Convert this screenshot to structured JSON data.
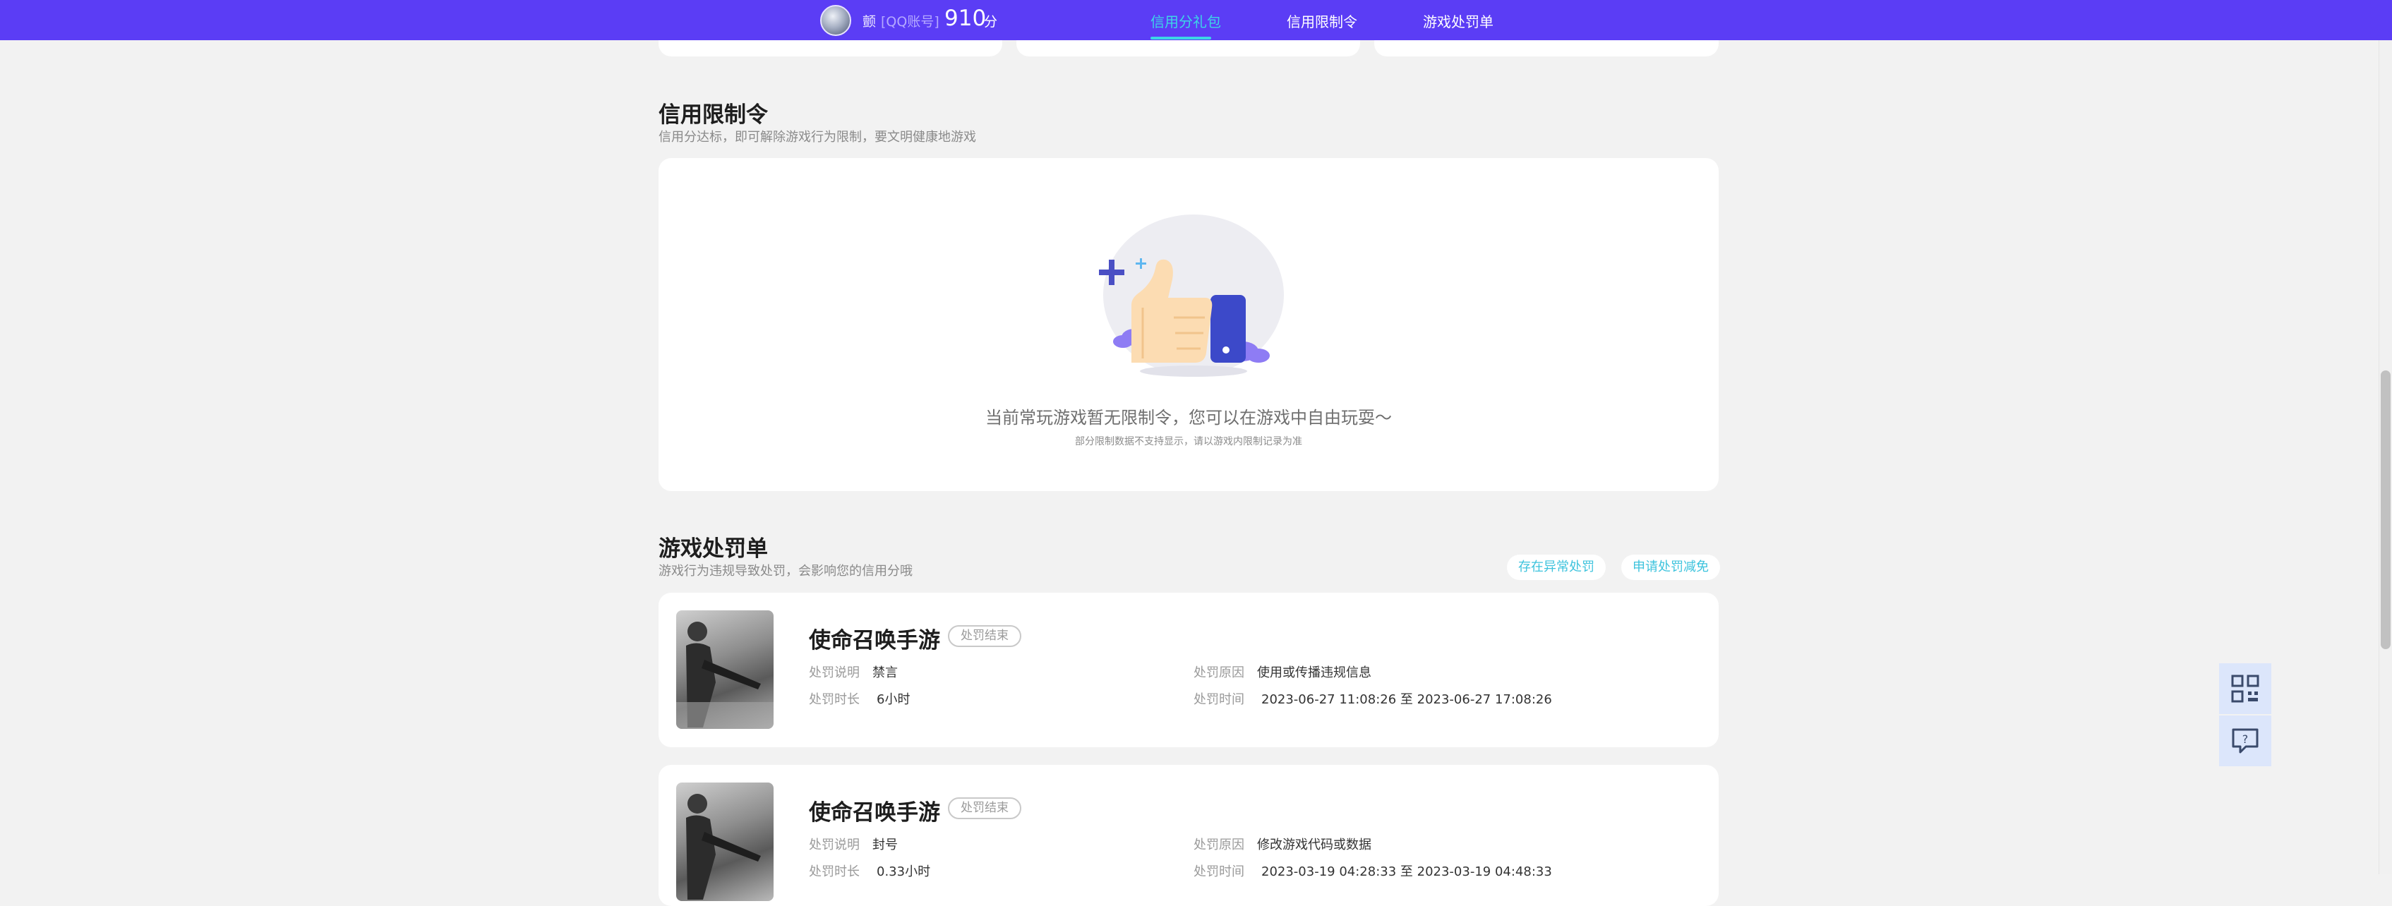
{
  "header": {
    "user_name": "颤",
    "account_type": "[QQ账号]",
    "score": "910",
    "score_unit": "分",
    "tabs": [
      {
        "label": "信用分礼包",
        "active": true
      },
      {
        "label": "信用限制令",
        "active": false
      },
      {
        "label": "游戏处罚单",
        "active": false
      }
    ]
  },
  "restriction": {
    "title": "信用限制令",
    "subtitle": "信用分达标，即可解除游戏行为限制，要文明健康地游戏",
    "empty_main": "当前常玩游戏暂无限制令，您可以在游戏中自由玩耍～",
    "empty_sub": "部分限制数据不支持显示，请以游戏内限制记录为准"
  },
  "penalty": {
    "title": "游戏处罚单",
    "subtitle": "游戏行为违规导致处罚，会影响您的信用分哦",
    "abnormal_button": "存在异常处罚",
    "appeal_button": "申请处罚减免",
    "labels": {
      "desc": "处罚说明",
      "reason": "处罚原因",
      "duration": "处罚时长",
      "time": "处罚时间"
    },
    "items": [
      {
        "game": "使命召唤手游",
        "status": "处罚结束",
        "desc": "禁言",
        "reason": "使用或传播违规信息",
        "duration": "6小时",
        "time": "2023-06-27 11:08:26 至 2023-06-27 17:08:26"
      },
      {
        "game": "使命召唤手游",
        "status": "处罚结束",
        "desc": "封号",
        "reason": "修改游戏代码或数据",
        "duration": "0.33小时",
        "time": "2023-03-19 04:28:33 至 2023-03-19 04:48:33"
      }
    ]
  },
  "sidebar": {
    "qr_icon": "qr-code-icon",
    "feedback_icon": "feedback-icon"
  },
  "colors": {
    "header_bg": "#5b3df5",
    "active_tab": "#3cd6e6",
    "link_blue": "#3dc3dd"
  }
}
